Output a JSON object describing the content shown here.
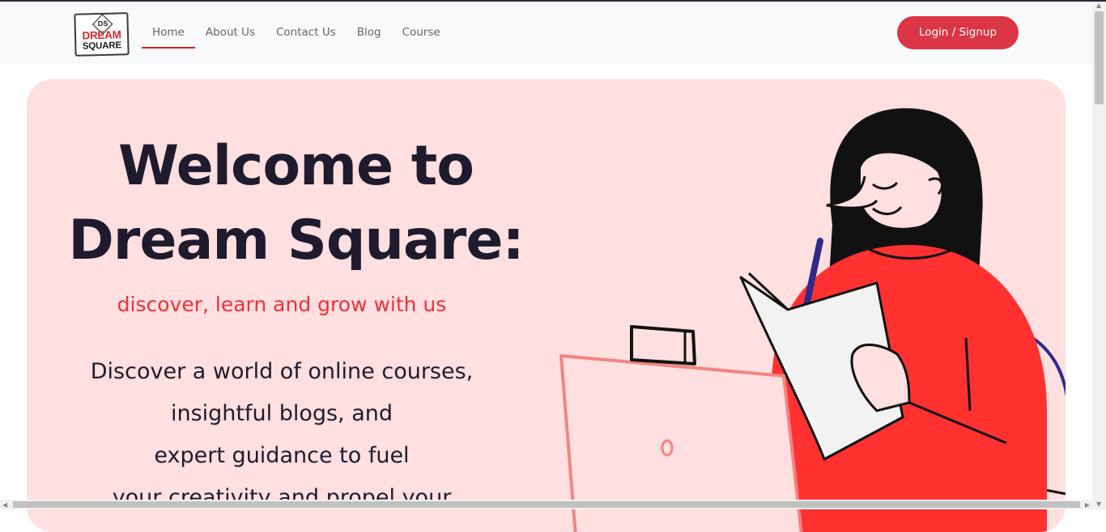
{
  "brand": {
    "monogram": "DS",
    "line1": "DREAM",
    "line2": "SQUARE"
  },
  "nav": {
    "items": [
      {
        "label": "Home",
        "active": true
      },
      {
        "label": "About Us",
        "active": false
      },
      {
        "label": "Contact Us",
        "active": false
      },
      {
        "label": "Blog",
        "active": false
      },
      {
        "label": "Course",
        "active": false
      }
    ],
    "login_label": "Login / Signup"
  },
  "hero": {
    "title_line1": "Welcome to",
    "title_line2": "Dream Square:",
    "tagline": "discover, learn and grow with us",
    "desc_lines": [
      "Discover a world of online courses,",
      "insightful blogs, and",
      "expert guidance to fuel",
      "your creativity and propel your"
    ]
  },
  "colors": {
    "accent": "#dc3545",
    "hero_bg": "#ffdfdf",
    "tagline": "#f0303a",
    "title": "#1f1b2e"
  },
  "icons": {
    "scroll_left": "◀",
    "scroll_right": "▶",
    "scroll_up": "▲",
    "scroll_down": "▼"
  }
}
